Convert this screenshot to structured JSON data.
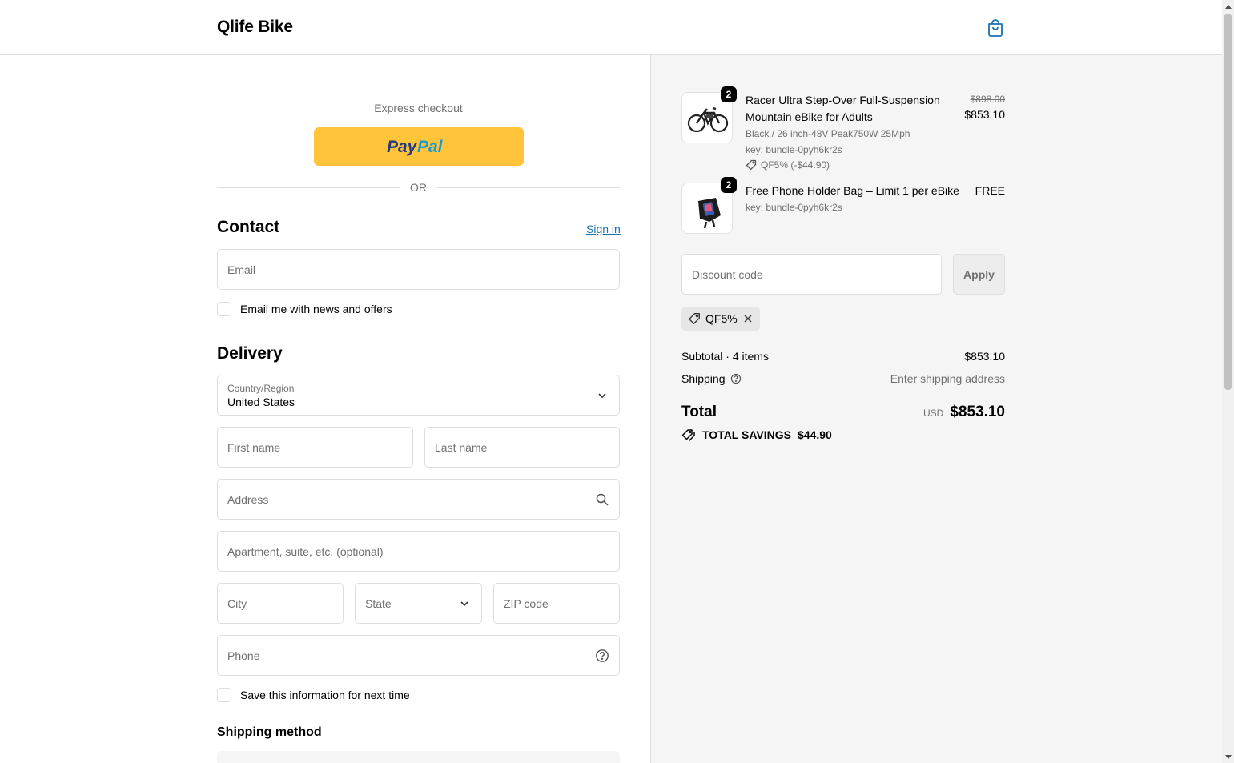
{
  "header": {
    "brand": "Qlife Bike",
    "cart_icon": "shopping-bag-icon"
  },
  "express": {
    "label": "Express checkout",
    "paypal_label": "PayPal",
    "or": "OR"
  },
  "contact": {
    "title": "Contact",
    "sign_in": "Sign in",
    "email_placeholder": "Email",
    "newsletter_label": "Email me with news and offers"
  },
  "delivery": {
    "title": "Delivery",
    "country_label": "Country/Region",
    "country_value": "United States",
    "first_name": "First name",
    "last_name": "Last name",
    "address": "Address",
    "apartment": "Apartment, suite, etc. (optional)",
    "city": "City",
    "state": "State",
    "zip": "ZIP code",
    "phone": "Phone",
    "save_info_label": "Save this information for next time"
  },
  "shipping_method": {
    "title": "Shipping method"
  },
  "order": {
    "items": [
      {
        "qty": "2",
        "title": "Racer Ultra Step-Over Full-Suspension Mountain eBike for Adults",
        "variant": "Black / 26 inch-48V Peak750W 25Mph",
        "key": "key: bundle-0pyh6kr2s",
        "discount": "QF5% (-$44.90)",
        "price_old": "$898.00",
        "price": "$853.10"
      },
      {
        "qty": "2",
        "title": "Free Phone Holder Bag – Limit 1 per eBike",
        "key": "key: bundle-0pyh6kr2s",
        "price": "FREE"
      }
    ],
    "discount_placeholder": "Discount code",
    "apply": "Apply",
    "applied_code": "QF5%",
    "subtotal_label": "Subtotal · 4 items",
    "subtotal_value": "$853.10",
    "shipping_label": "Shipping",
    "shipping_value": "Enter shipping address",
    "total_label": "Total",
    "total_currency": "USD",
    "total_value": "$853.10",
    "savings_label": "TOTAL SAVINGS",
    "savings_value": "$44.90"
  },
  "colors": {
    "paypal": "#ffc439",
    "link": "#1773b0",
    "summary_bg": "#f5f5f5"
  }
}
